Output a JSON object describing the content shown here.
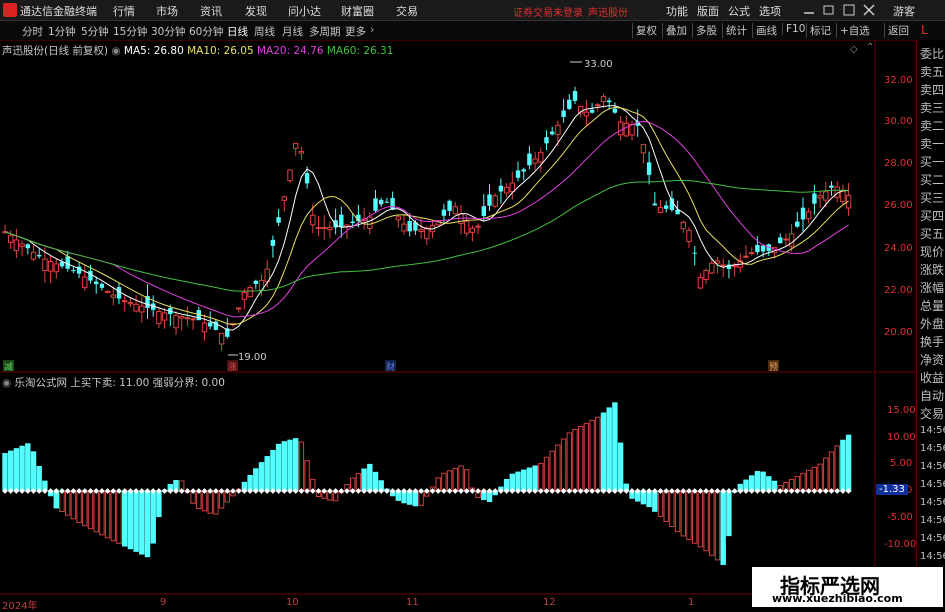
{
  "titlebar": {
    "app_name": "通达信金融终端",
    "menus": [
      "行情",
      "市场",
      "资讯",
      "发现",
      "问小达",
      "财富圈",
      "交易"
    ],
    "status": "证券交易未登录",
    "stock_name": "声迅股份",
    "right_items": [
      "功能",
      "版面",
      "公式",
      "选项"
    ],
    "user": "游客",
    "window_controls": [
      "minimize-icon",
      "maximize-icon",
      "close-icon"
    ]
  },
  "toolbar": {
    "periods": [
      "分时",
      "1分钟",
      "5分钟",
      "15分钟",
      "30分钟",
      "60分钟",
      "日线",
      "周线",
      "月线",
      "多周期",
      "更多"
    ],
    "active_period": "日线",
    "buttons": [
      "复权",
      "叠加",
      "多股",
      "统计",
      "画线",
      "F10",
      "标记",
      "+自选",
      "返回"
    ]
  },
  "main_chart": {
    "title": "声迅股份(日线 前复权)",
    "ma": [
      {
        "label": "MA5: 26.80",
        "color": "#ffffff"
      },
      {
        "label": "MA10: 26.05",
        "color": "#e8e060"
      },
      {
        "label": "MA20: 24.76",
        "color": "#e040e0"
      },
      {
        "label": "MA60: 26.31",
        "color": "#40c040"
      }
    ],
    "high_label": "33.00",
    "low_label": "19.00",
    "y_ticks": [
      "32.00",
      "30.00",
      "28.00",
      "26.00",
      "24.00",
      "22.00",
      "20.00"
    ],
    "event_marks": [
      {
        "label": "减",
        "color": "#40a040"
      },
      {
        "label": "涨",
        "color": "#c03030"
      },
      {
        "label": "财",
        "color": "#4060c0"
      },
      {
        "label": "预",
        "color": "#c08040"
      }
    ]
  },
  "indicator": {
    "title": "乐淘公式网 上买下卖: 11.00 强弱分界: 0.00",
    "y_ticks": [
      "15.00",
      "10.00",
      "5.00",
      "0.00",
      "-5.00",
      "-10.00"
    ],
    "current_value": "-1.33"
  },
  "x_axis": {
    "labels": [
      "2024年",
      "9",
      "10",
      "11",
      "12",
      "1"
    ]
  },
  "side_panel": {
    "items": [
      "委比",
      "卖五",
      "卖四",
      "卖三",
      "卖二",
      "卖一",
      "买一",
      "买二",
      "买三",
      "买四",
      "买五",
      "现价",
      "涨跌",
      "涨幅",
      "总量",
      "外盘",
      "换手",
      "净资",
      "收益"
    ],
    "items2": [
      "自动",
      "交易"
    ],
    "times": [
      "14:56",
      "14:56",
      "14:56",
      "14:56",
      "14:56",
      "14:56",
      "14:56",
      "14:56"
    ],
    "top_letter": "L"
  },
  "watermark": {
    "title": "指标严选网",
    "url": "www.xuezhibiao.com"
  },
  "chart_data": {
    "type": "candlestick",
    "panels": [
      {
        "name": "price",
        "ylim": [
          19,
          33
        ],
        "high": 33.0,
        "low": 19.0,
        "ma_latest": {
          "MA5": 26.8,
          "MA10": 26.05,
          "MA20": 24.76,
          "MA60": 26.31
        }
      },
      {
        "name": "indicator",
        "type": "bar",
        "ylim": [
          -12,
          18
        ],
        "latest": 11.0,
        "threshold": 0.0
      }
    ]
  }
}
